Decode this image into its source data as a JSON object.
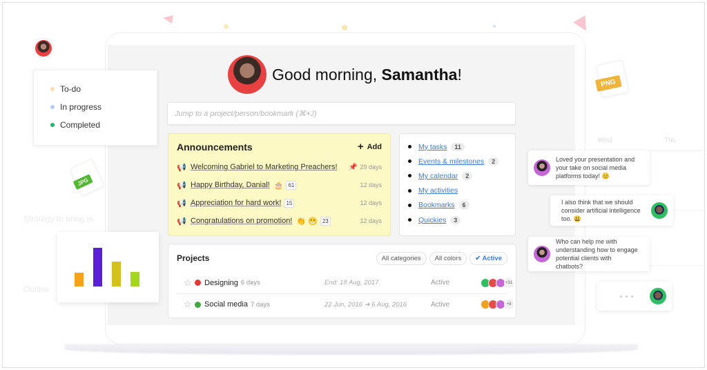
{
  "greeting": {
    "prefix": "Good morning, ",
    "name": "Samantha",
    "suffix": "!"
  },
  "search": {
    "placeholder": "Jump to a project/person/bookmark (⌘+J)",
    "value": ""
  },
  "status_legend": [
    {
      "label": "To-do",
      "color": "#f7deaa"
    },
    {
      "label": "In progress",
      "color": "#b3cdf2"
    },
    {
      "label": "Completed",
      "color": "#1dbb6e"
    }
  ],
  "announcements": {
    "title": "Announcements",
    "add_label": "Add",
    "items": [
      {
        "title": "Welcoming Gabriel to Marketing Preachers!",
        "emoji": "",
        "count": "",
        "pinned": true,
        "age": "29 days"
      },
      {
        "title": "Happy Birthday, Danial!",
        "emoji": "🎂",
        "count": "61",
        "pinned": false,
        "age": "12 days"
      },
      {
        "title": "Appreciation for hard work!",
        "emoji": "",
        "count": "15",
        "pinned": false,
        "age": "12 days"
      },
      {
        "title": "Congratulations on promotion!",
        "emoji": "👏 😁",
        "count": "23",
        "pinned": false,
        "age": "12 days"
      }
    ]
  },
  "quick_links": [
    {
      "label": "My tasks",
      "count": "11"
    },
    {
      "label": "Events & milestones",
      "count": "2"
    },
    {
      "label": "My calendar",
      "count": "2"
    },
    {
      "label": "My activities",
      "count": ""
    },
    {
      "label": "Bookmarks",
      "count": "6"
    },
    {
      "label": "Quickies",
      "count": "3"
    }
  ],
  "projects": {
    "title": "Projects",
    "filters": [
      {
        "label": "All categories",
        "active": false
      },
      {
        "label": "All colors",
        "active": false
      },
      {
        "label": "✔ Active",
        "active": true
      }
    ],
    "rows": [
      {
        "name": "Designing",
        "days": "6 days",
        "color": "#e53935",
        "date": "End: 18 Aug, 2017",
        "status": "Active",
        "extra_members": "+31",
        "member_colors": [
          "#2fbe62",
          "#e84a4a",
          "#c667d6"
        ]
      },
      {
        "name": "Social media",
        "days": "7 days",
        "color": "#43a843",
        "date": "22 Jun, 2016 ➔ 6 Aug, 2016",
        "status": "Active",
        "extra_members": "+8",
        "member_colors": [
          "#f0a020",
          "#e84a4a",
          "#c667d6"
        ]
      }
    ]
  },
  "chat": [
    {
      "text": "Loved your presentation and your take on social media platforms today! 😊",
      "side": "left"
    },
    {
      "text": "I also think that we should consider artificial intelligence too. 😃",
      "side": "right"
    },
    {
      "text": "Who can help me with understanding how to engage potential clients with chatbots?",
      "side": "left"
    },
    {
      "text": "",
      "side": "right",
      "typing": true
    }
  ],
  "file_badges": {
    "jpg": "JPG",
    "png": "PNG"
  },
  "background": {
    "calendar_days": [
      "Wed",
      "Thu"
    ],
    "left_text": [
      "Strategy to bring in",
      "Outline"
    ]
  },
  "mini_chart": {
    "bars": [
      {
        "value": 0.35,
        "color": "#f7a21b"
      },
      {
        "value": 1.0,
        "color": "#5b1fd6"
      },
      {
        "value": 0.64,
        "color": "#d6c01e"
      },
      {
        "value": 0.37,
        "color": "#a5d61e"
      }
    ]
  }
}
